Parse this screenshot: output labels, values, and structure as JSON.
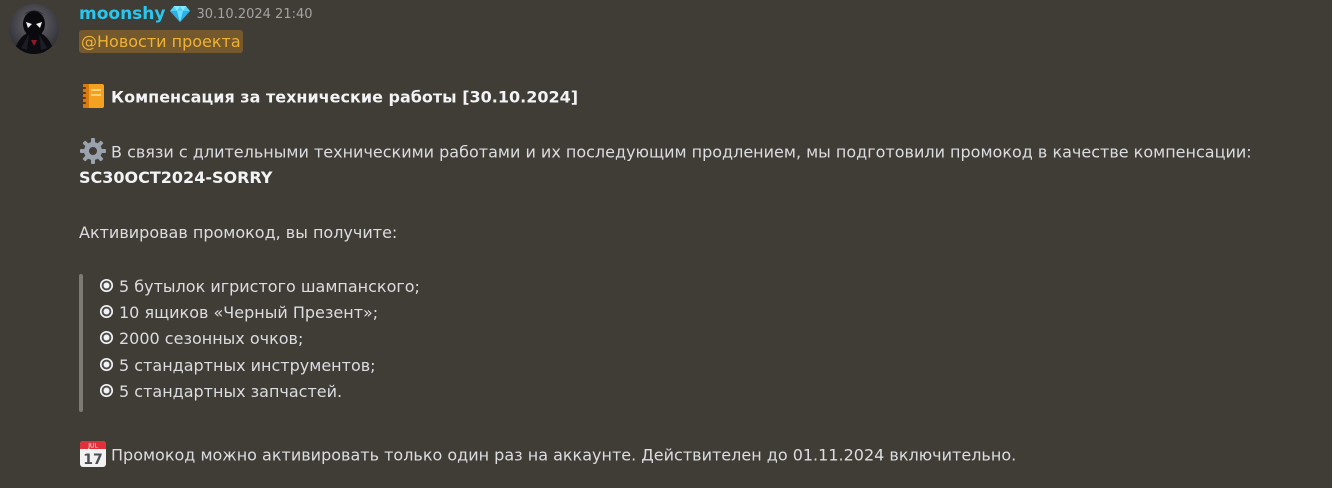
{
  "message": {
    "author": "moonshy",
    "author_badge": "diamond-icon",
    "timestamp": "30.10.2024 21:40",
    "mention": "@Новости проекта",
    "title_emoji": "notebook-icon",
    "title": "Компенсация за технические работы [30.10.2024]",
    "intro_emoji": "gear-icon",
    "intro": "В связи с длительными техническими работами и их последующим продлением, мы подготовили промокод в качестве компенсации:",
    "promo_code": "SC30OCT2024-SORRY",
    "activate_text": "Активировав промокод, вы получите:",
    "rewards": [
      "5 бутылок игристого шампанского;",
      "10 ящиков «Черный Презент»;",
      "2000 сезонных очков;",
      "5 стандартных инструментов;",
      "5 стандартных запчастей."
    ],
    "footer_emoji": "calendar-icon",
    "calendar_month": "JUL",
    "calendar_day": "17",
    "footer": "Промокод можно активировать только один раз на аккаунте. Действителен до 01.11.2024 включительно."
  },
  "colors": {
    "background": "#403c36",
    "username": "#28c7f0",
    "mention_text": "#f0b232",
    "text": "#dcdde1",
    "quote_bar": "#7d7a74"
  }
}
